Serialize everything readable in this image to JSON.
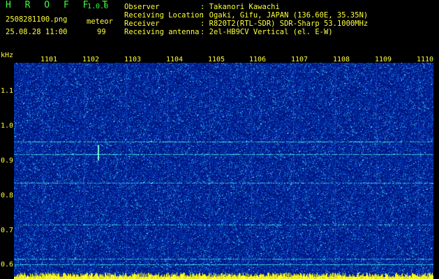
{
  "app": {
    "title": "H R O F F T",
    "version": "1.0.0",
    "filename": "2508281100.png",
    "timestamp": "25.08.28 11:00",
    "mode_label": "meteor",
    "count": "99"
  },
  "info": {
    "observer_label": "Observer",
    "observer_value": ": Takanori Kawachi",
    "location_label": "Receiving Location",
    "location_value": ": Ogaki, Gifu, JAPAN (136.60E, 35.35N)",
    "receiver_label": "Receiver",
    "receiver_value": ": R820T2(RTL-SDR) SDR-Sharp 53.1000MHz",
    "antenna_label": "Receiving antenna",
    "antenna_value": ": 2el-HB9CV Vertical (el. E-W)"
  },
  "axis": {
    "unit": "kHz",
    "minutes": [
      "1101",
      "1102",
      "1103",
      "1104",
      "1105",
      "1106",
      "1107",
      "1108",
      "1109",
      "1110"
    ],
    "freq_ticks": [
      "1.1",
      "1.0",
      "0.9",
      "0.8",
      "0.7",
      "0.6"
    ]
  },
  "colors": {
    "background": "#000000",
    "header_green": "#3cff3c",
    "header_yellow": "#ffff3c",
    "noise_base": "#001a80",
    "signal": "#40ffd0"
  }
}
